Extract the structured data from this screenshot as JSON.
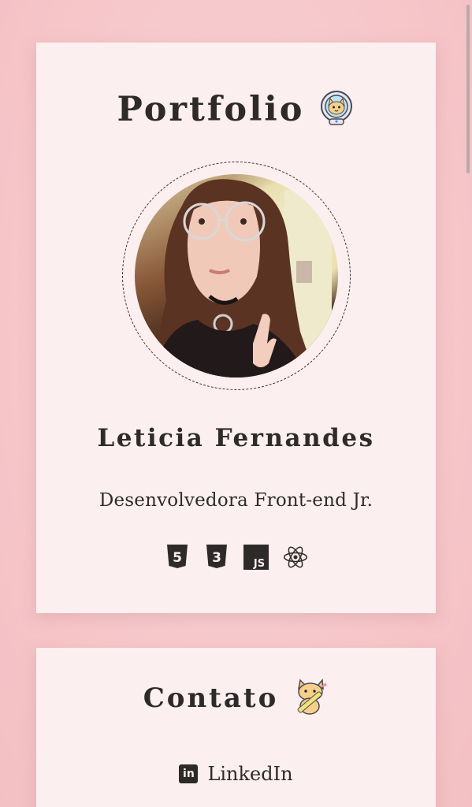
{
  "portfolio": {
    "title": "Portfolio",
    "title_emoji": "astronaut-cat-sticker",
    "avatar": "profile-photo",
    "name": "Leticia Fernandes",
    "role": "Desenvolvedora Front-end Jr.",
    "tech_icons": [
      "html5-icon",
      "css3-icon",
      "javascript-icon",
      "react-icon"
    ],
    "tech_labels": {
      "html": "5",
      "css": "3",
      "js": "JS"
    }
  },
  "contact": {
    "title": "Contato",
    "title_emoji": "cat-with-pencil-sticker",
    "linkedin_badge": "in",
    "linkedin_label": "LinkedIn"
  },
  "colors": {
    "background": "#f6c7ca",
    "card": "#fcefef",
    "text": "#2e2a2a"
  }
}
